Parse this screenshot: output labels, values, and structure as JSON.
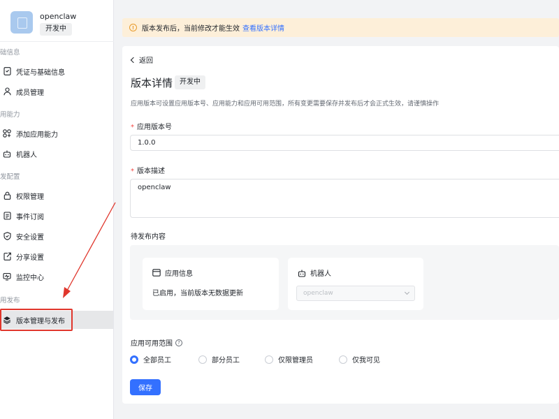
{
  "app": {
    "name": "openclaw",
    "status": "开发中"
  },
  "sidebar": {
    "sections": [
      {
        "title": "础信息",
        "items": [
          {
            "label": "凭证与基础信息",
            "icon": "credential-icon"
          },
          {
            "label": "成员管理",
            "icon": "user-icon"
          }
        ]
      },
      {
        "title": "用能力",
        "items": [
          {
            "label": "添加应用能力",
            "icon": "grid-icon"
          },
          {
            "label": "机器人",
            "icon": "robot-icon"
          }
        ]
      },
      {
        "title": "发配置",
        "items": [
          {
            "label": "权限管理",
            "icon": "lock-icon"
          },
          {
            "label": "事件订阅",
            "icon": "event-icon"
          },
          {
            "label": "安全设置",
            "icon": "shield-icon"
          },
          {
            "label": "分享设置",
            "icon": "share-icon"
          },
          {
            "label": "监控中心",
            "icon": "monitor-icon"
          }
        ]
      },
      {
        "title": "用发布",
        "items": [
          {
            "label": "版本管理与发布",
            "icon": "layers-icon",
            "active": true
          }
        ]
      }
    ]
  },
  "banner": {
    "text": "版本发布后，当前修改才能生效",
    "link": "查看版本详情"
  },
  "page": {
    "back": "返回",
    "title": "版本详情",
    "status": "开发中",
    "description": "应用版本可设置应用版本号、应用能力和应用可用范围，所有变更需要保存并发布后才会正式生效，请谨慎操作"
  },
  "form": {
    "version_label": "应用版本号",
    "version_value": "1.0.0",
    "desc_label": "版本描述",
    "desc_value": "openclaw",
    "pending_label": "待发布内容",
    "app_info": {
      "title": "应用信息",
      "text": "已启用，当前版本无数据更新"
    },
    "bot": {
      "title": "机器人",
      "select_value": "openclaw"
    },
    "scope_label": "应用可用范围",
    "scope_options": [
      "全部员工",
      "部分员工",
      "仅限管理员",
      "仅我可见"
    ],
    "scope_selected": "全部员工",
    "save": "保存"
  },
  "colors": {
    "primary": "#3370ff",
    "banner_bg": "#fdefd9",
    "warning": "#e89b2c",
    "annotation": "#e0362c"
  }
}
